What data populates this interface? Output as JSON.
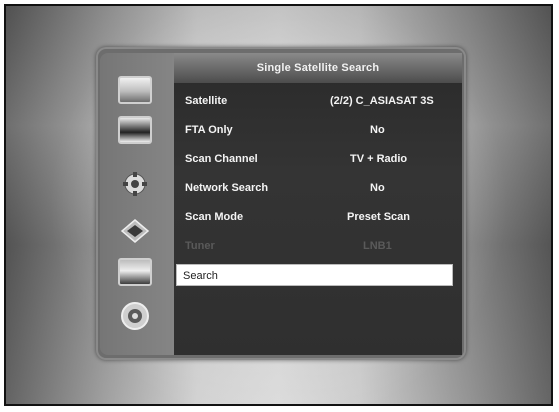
{
  "header": {
    "title": "Single Satellite Search"
  },
  "settings": [
    {
      "label": "Satellite",
      "value": "(2/2) C_ASIASAT 3S"
    },
    {
      "label": "FTA Only",
      "value": "No"
    },
    {
      "label": "Scan Channel",
      "value": "TV + Radio"
    },
    {
      "label": "Network Search",
      "value": "No"
    },
    {
      "label": "Scan Mode",
      "value": "Preset Scan"
    },
    {
      "label": "Tuner",
      "value": "LNB1"
    }
  ],
  "search": {
    "label": "Search"
  },
  "sidebar": {
    "icons": [
      "tv-icon",
      "picture-icon",
      "gear-icon",
      "tools-icon",
      "landscape-icon",
      "disc-icon"
    ]
  }
}
